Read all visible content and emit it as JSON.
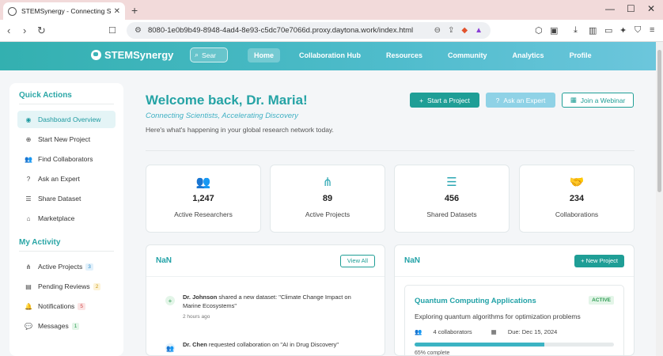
{
  "browser": {
    "tab_title": "STEMSynergy - Connecting Scie",
    "url": "8080-1e0b9b49-8948-4ad4-8e93-c5dc70e7066d.proxy.daytona.work/index.html"
  },
  "header": {
    "brand": "STEMSynergy",
    "search_placeholder": "Sear",
    "nav": [
      "Home",
      "Collaboration Hub",
      "Resources",
      "Community",
      "Analytics",
      "Profile"
    ]
  },
  "sidebar": {
    "quick_title": "Quick Actions",
    "quick": [
      "Dashboard Overview",
      "Start New Project",
      "Find Collaborators",
      "Ask an Expert",
      "Share Dataset",
      "Marketplace"
    ],
    "activity_title": "My Activity",
    "activity": [
      {
        "label": "Active Projects",
        "badge": "3"
      },
      {
        "label": "Pending Reviews",
        "badge": "2"
      },
      {
        "label": "Notifications",
        "badge": "5"
      },
      {
        "label": "Messages",
        "badge": "1"
      }
    ]
  },
  "main": {
    "welcome": "Welcome back, Dr. Maria!",
    "tagline": "Connecting Scientists, Accelerating Discovery",
    "subtitle": "Here's what's happening in your global research network today.",
    "buttons": {
      "start": "Start a Project",
      "ask": "Ask an Expert",
      "webinar": "Join a Webinar"
    },
    "stats": [
      {
        "value": "1,247",
        "label": "Active Researchers"
      },
      {
        "value": "89",
        "label": "Active Projects"
      },
      {
        "value": "456",
        "label": "Shared Datasets"
      },
      {
        "value": "234",
        "label": "Collaborations"
      }
    ],
    "feed": {
      "title": "NaN",
      "view_all": "View All",
      "items": [
        {
          "author": "Dr. Johnson",
          "text": " shared a new dataset: \"Climate Change Impact on Marine Ecosystems\"",
          "time": "2 hours ago"
        },
        {
          "author": "Dr. Chen",
          "text": " requested collaboration on \"AI in Drug Discovery\"",
          "time": ""
        }
      ]
    },
    "projects": {
      "title": "NaN",
      "new_label": "New Project",
      "card": {
        "title": "Quantum Computing Applications",
        "status": "ACTIVE",
        "desc": "Exploring quantum algorithms for optimization problems",
        "collaborators": "4 collaborators",
        "due": "Due: Dec 15, 2024",
        "progress": 0.65,
        "progress_label": "65% complete"
      }
    }
  }
}
